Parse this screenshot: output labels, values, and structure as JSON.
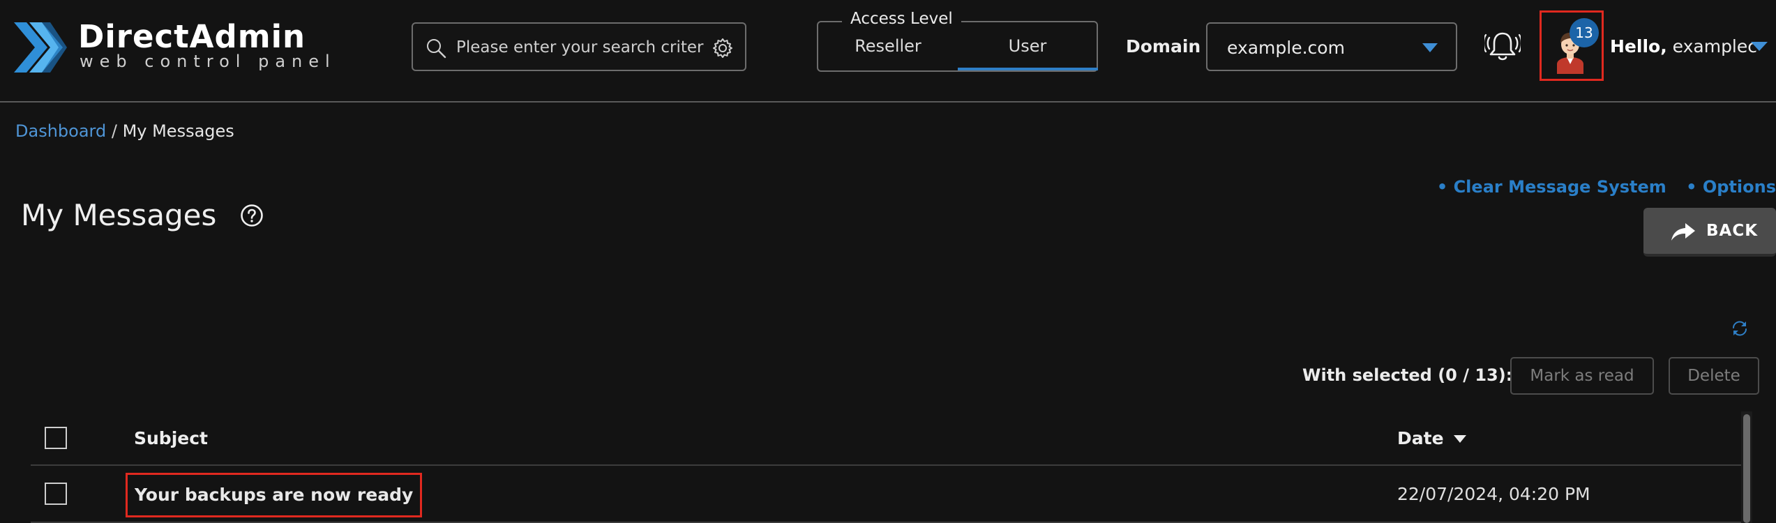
{
  "header": {
    "logo": {
      "title": "DirectAdmin",
      "subtitle": "web control panel"
    },
    "search": {
      "placeholder": "Please enter your search criteria"
    },
    "access_level": {
      "legend": "Access Level",
      "tabs": [
        {
          "label": "Reseller",
          "active": false
        },
        {
          "label": "User",
          "active": true
        }
      ]
    },
    "domain": {
      "label": "Domain",
      "value": "example.com"
    },
    "notifications": {
      "badge_count": "13"
    },
    "user": {
      "greeting": "Hello,",
      "name": "examplec"
    }
  },
  "breadcrumb": {
    "home": "Dashboard",
    "separator": " / ",
    "current": "My Messages"
  },
  "page": {
    "title": "My Messages",
    "links": [
      {
        "label": "• Clear Message System"
      },
      {
        "label": "• Options"
      }
    ],
    "back_label": "BACK"
  },
  "toolbar": {
    "with_selected": "With selected (0 / 13):",
    "mark_as_read": "Mark as read",
    "delete": "Delete"
  },
  "table": {
    "columns": {
      "subject": "Subject",
      "date": "Date"
    },
    "rows": [
      {
        "subject": "Your backups are now ready",
        "date": "22/07/2024, 04:20 PM"
      }
    ]
  },
  "colors": {
    "background": "#131313",
    "accent": "#2f7fc6",
    "link": "#4f95d6",
    "highlight": "#e0291f",
    "badge": "#1c64a8"
  }
}
